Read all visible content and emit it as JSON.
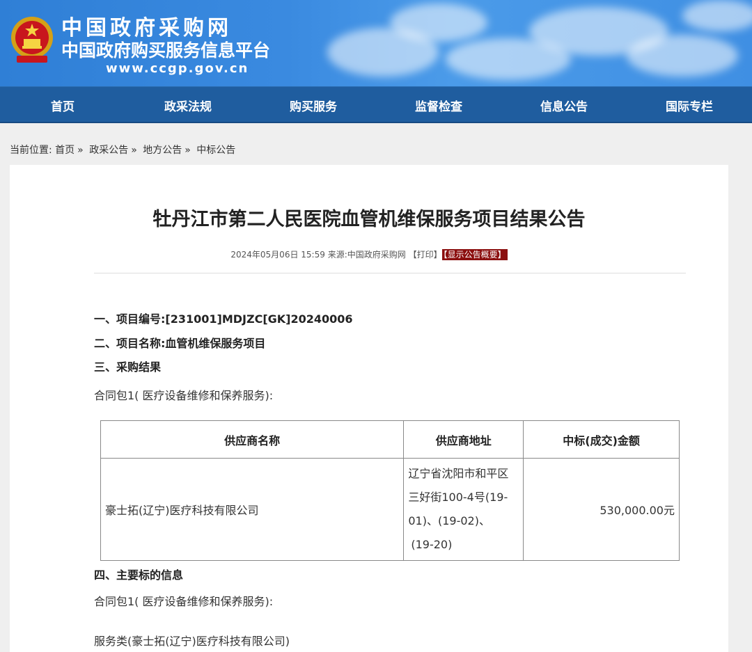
{
  "header": {
    "site_name": "中国政府采购网",
    "site_subtitle": "中国政府购买服务信息平台",
    "site_url": "www.ccgp.gov.cn",
    "emblem": "national-emblem-icon"
  },
  "nav": {
    "items": [
      "首页",
      "政采法规",
      "购买服务",
      "监督检查",
      "信息公告",
      "国际专栏"
    ]
  },
  "breadcrumb": {
    "label": "当前位置:",
    "items": [
      "首页",
      "政采公告",
      "地方公告",
      "中标公告"
    ],
    "separator": "»"
  },
  "article": {
    "title": "牡丹江市第二人民医院血管机维保服务项目结果公告",
    "meta": {
      "datetime": "2024年05月06日 15:59",
      "source_label": "来源:",
      "source": "中国政府采购网",
      "print": "【打印】",
      "summary": "【显示公告概要】"
    },
    "sections": {
      "project_no": "一、项目编号:[231001]MDJZC[GK]20240006",
      "project_name": "二、项目名称:血管机维保服务项目",
      "result_heading": "三、采购结果",
      "package_line": "合同包1( 医疗设备维修和保养服务):",
      "main_info_heading": "四、主要标的信息",
      "package_line_2": "合同包1( 医疗设备维修和保养服务):",
      "service_line": "服务类(豪士拓(辽宁)医疗科技有限公司)"
    },
    "table": {
      "headers": [
        "供应商名称",
        "供应商地址",
        "中标(成交)金额"
      ],
      "rows": [
        {
          "name": "豪士拓(辽宁)医疗科技有限公司",
          "address_lines": [
            "辽宁省沈阳市和平区",
            "三好街100-4号(19-",
            "01)、(19-02)、",
            "(19-20)"
          ],
          "amount": "530,000.00元"
        }
      ]
    }
  },
  "colors": {
    "header_blue": "#3a8ae0",
    "nav_blue": "#1f5d9f",
    "summary_red": "#8b0f0f"
  }
}
